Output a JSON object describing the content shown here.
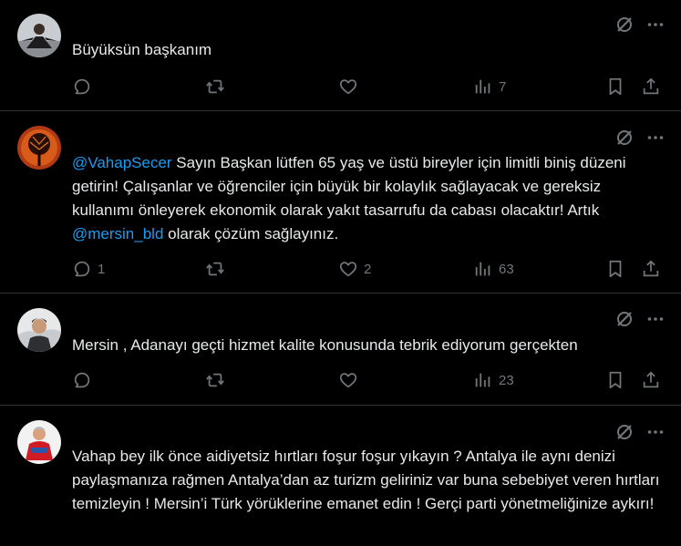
{
  "posts": [
    {
      "text": "Büyüksün başkanım",
      "replies": "",
      "likes": "",
      "views": "7"
    },
    {
      "mention1": "@VahapSecer",
      "text_a": " Sayın Başkan lütfen 65 yaş ve üstü bireyler için limitli biniş düzeni getirin! Çalışanlar ve öğrenciler için büyük bir kolaylık sağlayacak ve gereksiz kullanımı önleyerek ekonomik olarak yakıt tasarrufu da cabası olacaktır! Artık ",
      "mention2": "@mersin_bld",
      "text_b": " olarak çözüm sağlayınız.",
      "replies": "1",
      "likes": "2",
      "views": "63"
    },
    {
      "text": "Mersin , Adanayı geçti hizmet kalite konusunda tebrik ediyorum gerçekten",
      "replies": "",
      "likes": "",
      "views": "23"
    },
    {
      "text": "Vahap bey ilk önce aidiyetsiz hırtları foşur foşur yıkayın ? Antalya ile aynı denizi paylaşmanıza rağmen Antalya’dan az turizm geliriniz var buna sebebiyet veren hırtları temizleyin ! Mersin’i Türk yörüklerine emanet edin ! Gerçi parti yönetmeliğinize aykırı!"
    }
  ],
  "icons": {
    "grok": "grok-icon",
    "more": "more-icon",
    "reply": "reply-icon",
    "repost": "repost-icon",
    "like": "like-icon",
    "views": "views-icon",
    "bookmark": "bookmark-icon",
    "share": "share-icon"
  },
  "colors": {
    "background": "#000000",
    "text": "#e7e9ea",
    "muted": "#71767b",
    "link": "#1d9bf0",
    "divider": "#2f3336"
  }
}
